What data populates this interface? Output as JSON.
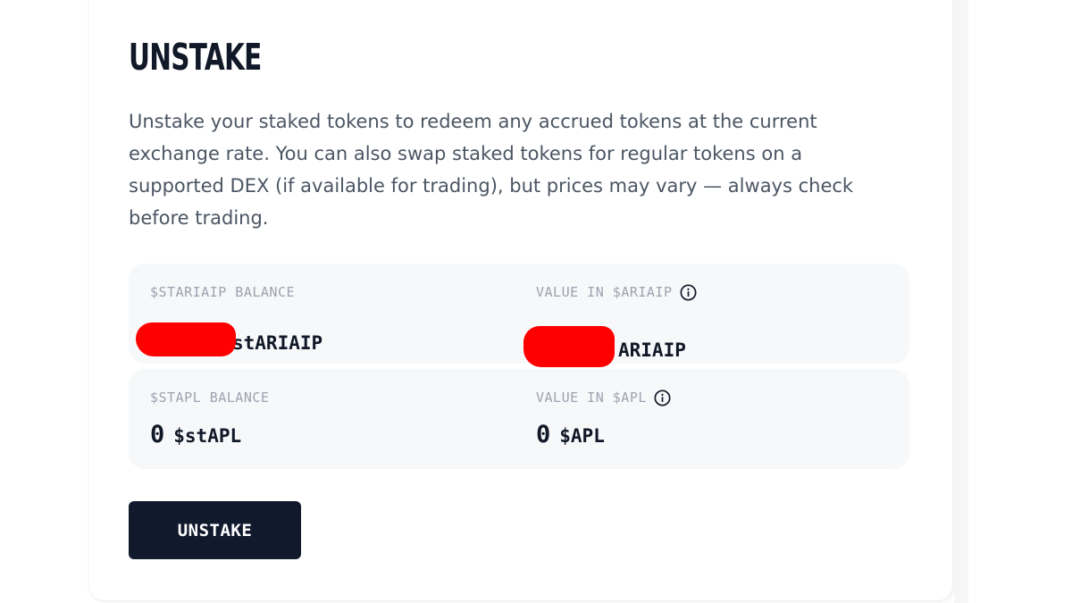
{
  "unstake": {
    "title": "UNSTAKE",
    "description": "Unstake your staked tokens to redeem any accrued tokens at the current exchange rate. You can also swap staked tokens for regular tokens on a supported DEX (if available for trading), but prices may vary — always check before trading.",
    "button_label": "UNSTAKE"
  },
  "balances": [
    {
      "balance_label": "$STARIAIP BALANCE",
      "balance_value": "",
      "balance_unit": "stARIAIP",
      "value_label": "VALUE IN $ARIAIP",
      "value_value": "",
      "value_unit": "ARIAIP"
    },
    {
      "balance_label": "$STAPL BALANCE",
      "balance_value": "0",
      "balance_unit": "$stAPL",
      "value_label": "VALUE IN $APL",
      "value_value": "0",
      "value_unit": "$APL"
    }
  ],
  "colors": {
    "button_bg": "#111a2c",
    "panel_bg": "#f7f8fa",
    "redaction": "#ff0000"
  }
}
